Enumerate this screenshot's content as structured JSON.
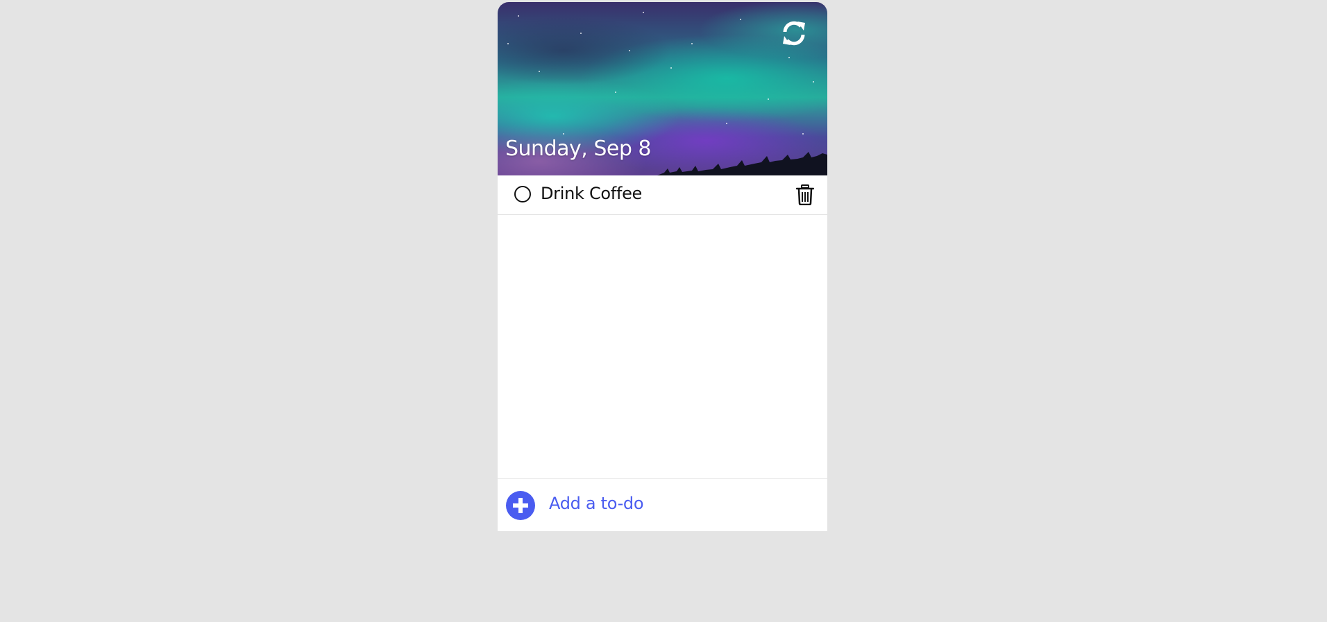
{
  "header": {
    "date": "Sunday, Sep 8",
    "refresh_icon": "refresh-icon",
    "background": "aurora-night-sky"
  },
  "todos": [
    {
      "text": "Drink Coffee",
      "completed": false
    }
  ],
  "footer": {
    "add_label": "Add a to-do",
    "add_icon": "plus-icon"
  },
  "colors": {
    "accent": "#4a5cf0",
    "page_background": "#e4e4e4",
    "card_background": "#ffffff"
  }
}
